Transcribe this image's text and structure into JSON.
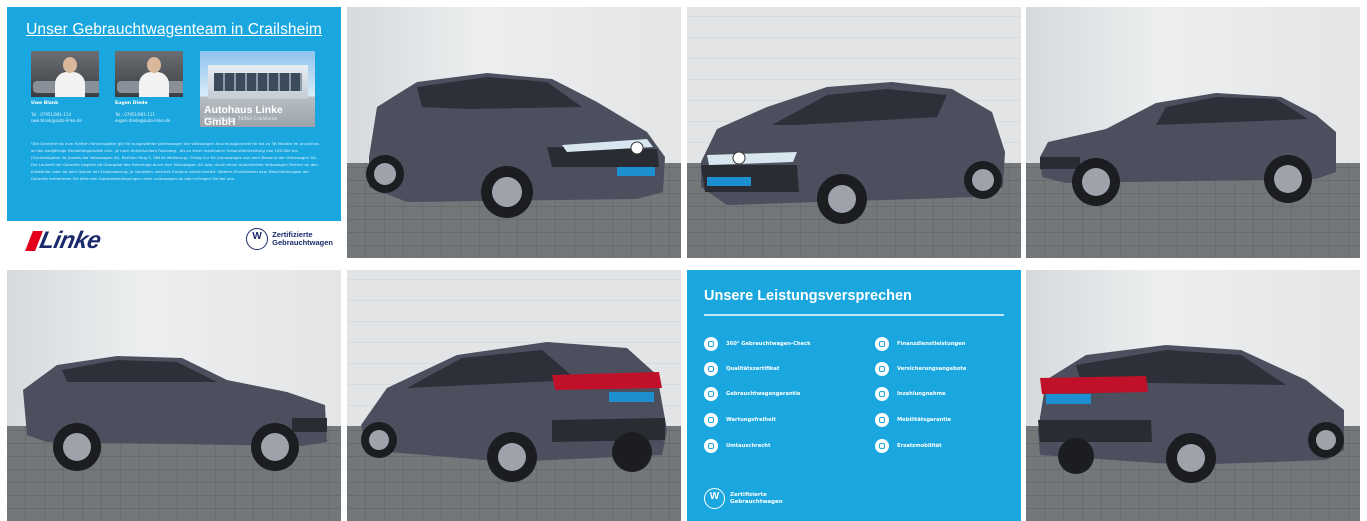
{
  "team_tile": {
    "heading": "Unser Gebrauchtwagenteam in Crailsheim",
    "building_label": "Autohaus Linke GmbH",
    "building_address": "Heller-Straße · 74564 Crailsheim",
    "persons": [
      {
        "name": "Uwe Blank",
        "phone": "Tel.: 07951/981-114",
        "email": "uwe.blank@auto-linke.de"
      },
      {
        "name": "Eugen Diede",
        "phone": "Tel.: 07951/981-111",
        "email": "eugen.diede@auto-linke.de"
      }
    ],
    "disclaimer": "¹Die Garantie bis zum fünften Fahrzeugalter gilt für ausgewählte Jahreswagen die Volkswagen Anschlussgarantie für bis zu 36 Monate im Anschluss an die zweijährige Herstellergarantie und - je nach individuellem Fahrzeug - bis zu einer maximalen Gesamtfahrleistung von 100.000 km (Garantiegeber ist jeweils die Volkswagen AG, Berliner Ring 2, 38440 Wolfsburg). Erfolg nur für Jahreswagen aus dem Bestand der Volkswagen AG. Die Laufzeit der Garantie beginnt ab Übergabe des Fahrzeugs durch den Volkswagen AG bzw. durch einen autorisierten Volkswagen Partner an den Erstkäufer oder ab dem Datum der Erstzulassung, je nachdem, welches Ereignis zuerst eintritt. Weitere Einzelheiten bzw. Beschränkungen der Garantie entnehmen Sie bitte den Garantiebedingungen unter volkswagen.de oder erfragen Sie bei uns.",
    "brand": "Linke",
    "cert_line1": "Zertifizierte",
    "cert_line2": "Gebrauchtwagen"
  },
  "photos": [
    {
      "name": "front-left-view"
    },
    {
      "name": "front-right-view"
    },
    {
      "name": "right-side-view"
    },
    {
      "name": "left-side-view"
    },
    {
      "name": "rear-left-view"
    },
    {
      "name": "rear-right-view"
    }
  ],
  "promise_tile": {
    "title": "Unsere Leistungsversprechen",
    "left_items": [
      "360° Gebrauchtwagen-Check",
      "Qualitätszertifikat",
      "Gebrauchtwagengarantie",
      "Wartungsfreiheit",
      "Umtauschrecht"
    ],
    "right_items": [
      "Finanzdienstleistungen",
      "Versicherungsangebote",
      "Inzahlungnahme",
      "Mobilitätsgarantie",
      "Ersatzmobilität"
    ],
    "cert_line1": "Zertifizierte",
    "cert_line2": "Gebrauchtwagen"
  },
  "colors": {
    "brand_blue": "#1aa7e0",
    "car_body": "#4b4f5e",
    "linke_navy": "#1b2a6b",
    "linke_red": "#e2001a"
  }
}
